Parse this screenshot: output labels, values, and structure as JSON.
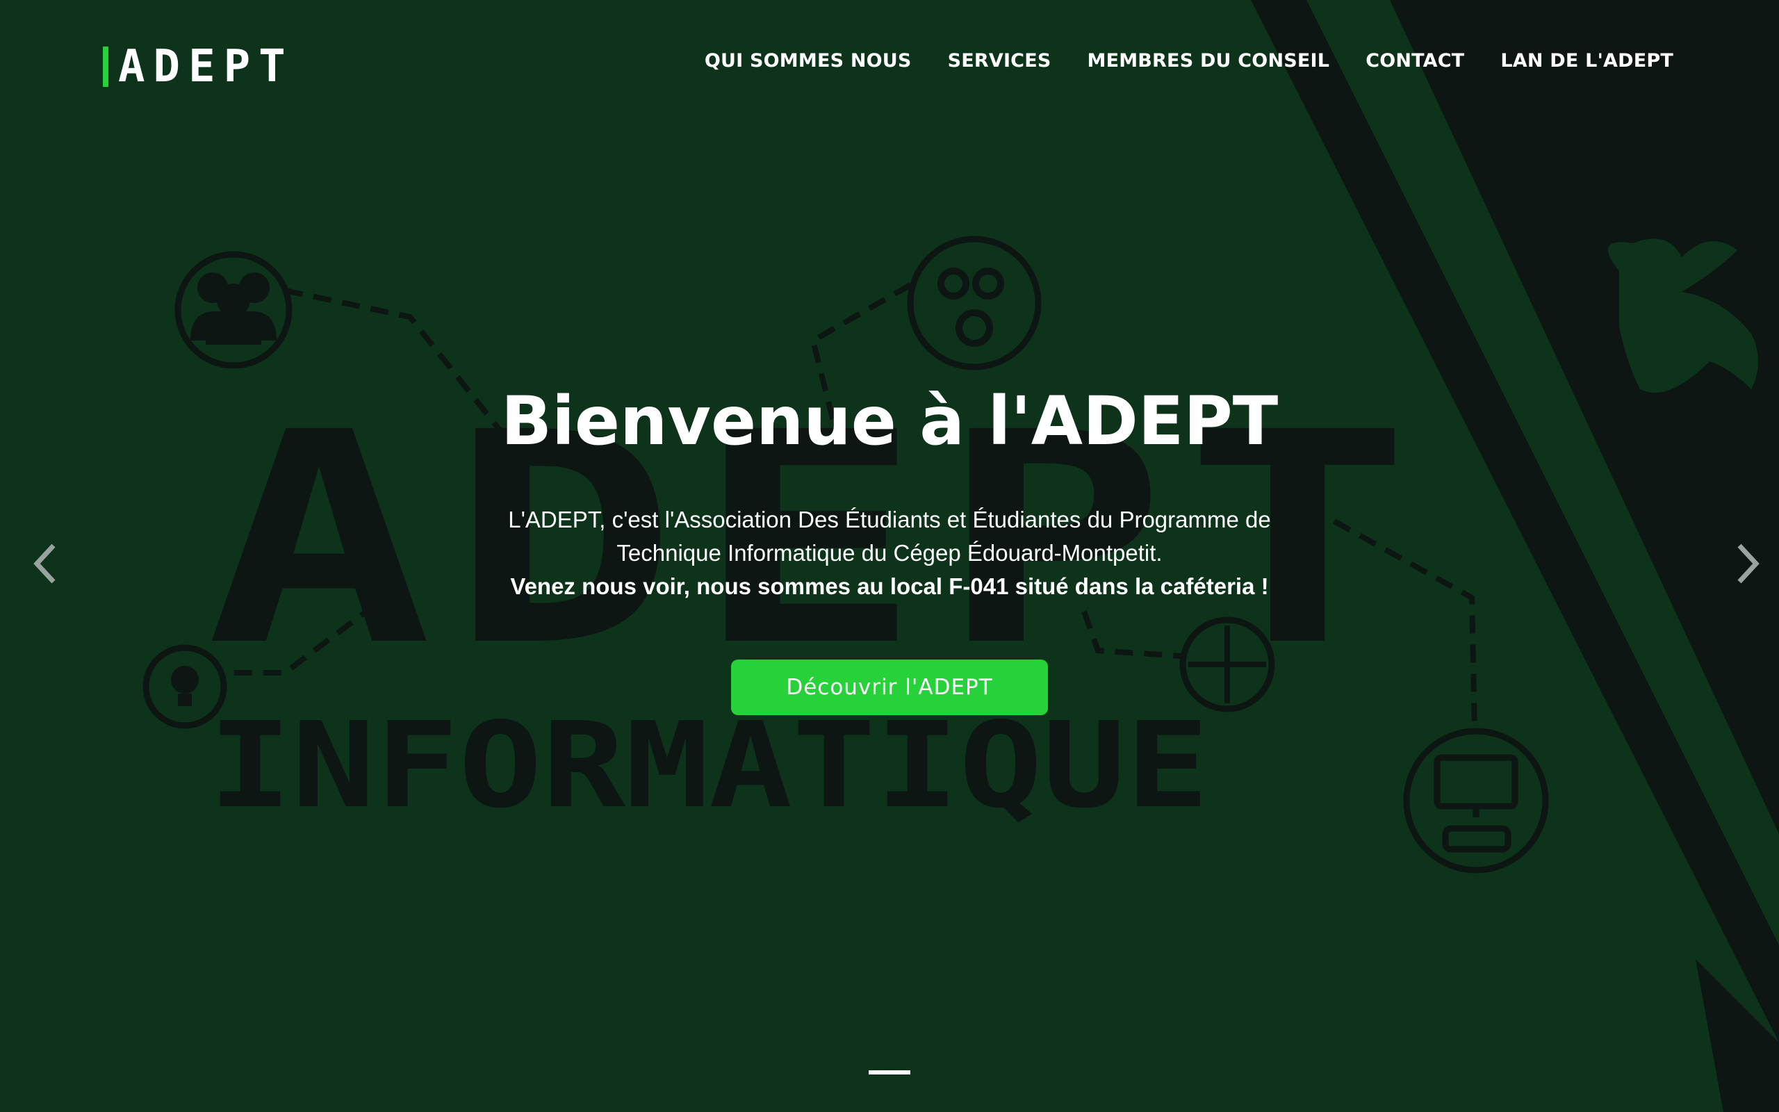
{
  "brand": {
    "logo_text": "ADEPT",
    "accent": "#27d13a",
    "background": "#0d331b",
    "dark": "#0e1613"
  },
  "nav": {
    "items": [
      {
        "label": "QUI SOMMES NOUS"
      },
      {
        "label": "SERVICES"
      },
      {
        "label": "MEMBRES DU CONSEIL"
      },
      {
        "label": "CONTACT"
      },
      {
        "label": "LAN DE L'ADEPT"
      }
    ]
  },
  "hero": {
    "title": "Bienvenue à l'ADEPT",
    "desc_line1": "L'ADEPT, c'est l'Association Des Étudiants et Étudiantes du Programme de Technique Informatique du Cégep Édouard-Montpetit.",
    "desc_bold": "Venez nous voir, nous sommes au local F-041 situé dans la caféteria !",
    "cta_label": "Découvrir l'ADEPT",
    "bg_word_1": "ADEPT",
    "bg_word_2": "INFORMATIQUE"
  },
  "carousel": {
    "prev_icon": "chevron-left-icon",
    "next_icon": "chevron-right-icon",
    "slide_count": 1,
    "active_slide": 1
  }
}
